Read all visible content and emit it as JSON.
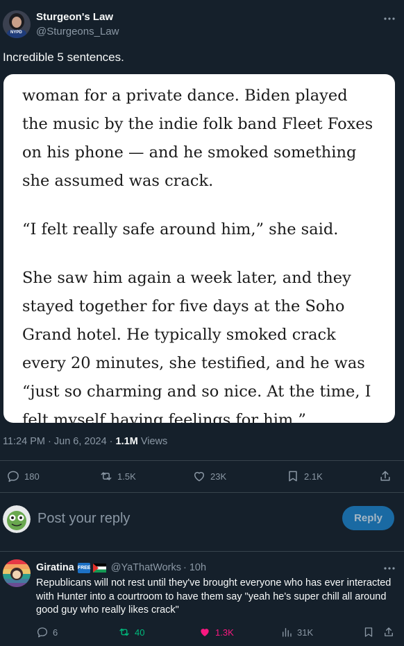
{
  "post": {
    "author_name": "Sturgeon's Law",
    "author_handle": "@Sturgeons_Law",
    "avatar_text": "NYPD",
    "text": "Incredible 5 sentences.",
    "image_paragraphs": [
      [
        "woman for a private dance. Biden played",
        "the music by the indie folk band Fleet Foxes",
        "on his phone — and he smoked something",
        "she assumed was crack."
      ],
      [
        "“I felt really safe around him,” she said."
      ],
      [
        "She saw him again a week later, and they",
        "stayed together for five days at the Soho",
        "Grand hotel. He typically smoked crack",
        "every 20 minutes, she testified, and he was",
        "“just so charming and so nice. At the time, I",
        "felt myself having feelings for him.”"
      ]
    ],
    "timestamp": "11:24 PM · Jun 6, 2024 · ",
    "views_count": "1.1M",
    "views_label": " Views",
    "stats": {
      "replies": "180",
      "reposts": "1.5K",
      "likes": "23K",
      "bookmarks": "2.1K"
    }
  },
  "compose": {
    "placeholder": "Post your reply",
    "reply_button": "Reply"
  },
  "reply": {
    "author_name": "Giratina",
    "badge_text": "FREE",
    "author_handle": "@YaThatWorks",
    "time": " · 10h",
    "text": "Republicans will not rest until they've brought everyone who has ever interacted with Hunter into a courtroom to have them say \"yeah he's super chill all around good guy who really likes crack\"",
    "stats": {
      "replies": "6",
      "reposts": "40",
      "likes": "1.3K",
      "views": "31K"
    }
  },
  "colors": {
    "background": "#15202b",
    "accent": "#1d9bf0",
    "reply_button_bg": "#1a6aa3",
    "repost_active": "#00ba7c",
    "like_active": "#f91880",
    "divider": "#38444d"
  },
  "icons": [
    "more-icon",
    "reply-icon",
    "repost-icon",
    "like-icon",
    "bookmark-icon",
    "share-icon",
    "views-icon"
  ]
}
